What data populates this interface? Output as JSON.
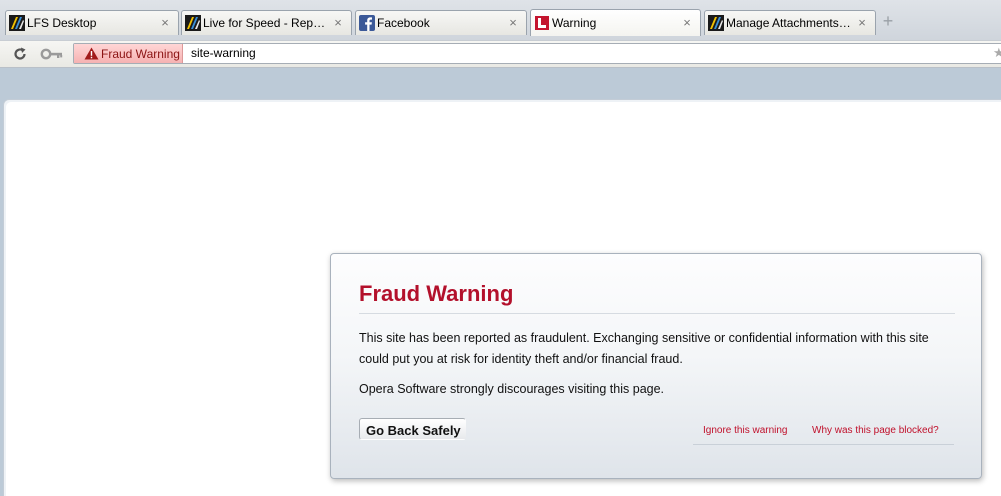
{
  "tabs": [
    {
      "label": "LFS Desktop",
      "favicon": "lfs-icon",
      "active": false
    },
    {
      "label": "Live for Speed - Reply to...",
      "favicon": "lfs-icon",
      "active": false
    },
    {
      "label": "Facebook",
      "favicon": "facebook-icon",
      "active": false
    },
    {
      "label": "Warning",
      "favicon": "opera-warning-icon",
      "active": true
    },
    {
      "label": "Manage Attachments - Li...",
      "favicon": "lfs-icon",
      "active": false
    }
  ],
  "tab_close_glyph": "×",
  "new_tab_glyph": "+",
  "address_bar": {
    "badge_label": "Fraud Warning",
    "url": "site-warning"
  },
  "warning": {
    "title": "Fraud Warning",
    "message": "This site has been reported as fraudulent. Exchanging sensitive or confidential information with this site could put you at risk for identity theft and/or financial fraud.",
    "discourage": "Opera Software strongly discourages visiting this page.",
    "go_back_label": "Go Back Safely",
    "ignore_label": "Ignore this warning",
    "why_label": "Why was this page blocked?"
  },
  "colors": {
    "warning_red": "#b3102b",
    "badge_bg": "#f6b2b2",
    "facebook_blue": "#3b5998"
  }
}
